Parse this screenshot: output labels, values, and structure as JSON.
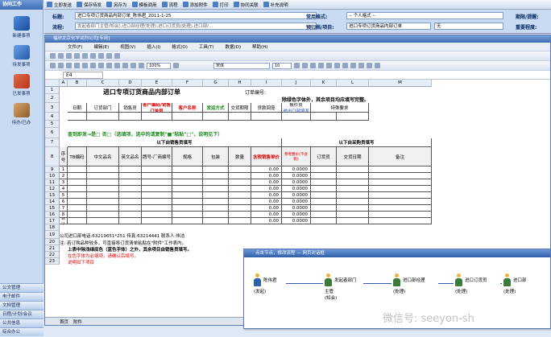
{
  "nav": {
    "header": "协同工作",
    "items": [
      {
        "label": "新建事项"
      },
      {
        "label": "待发事项"
      },
      {
        "label": "已发事项"
      },
      {
        "label": "待办/已办"
      }
    ],
    "bottom": [
      "公文管理",
      "电子邮件",
      "文档管理",
      "日程/计划/会议",
      "公共信息",
      "综合办公"
    ]
  },
  "toolbar": {
    "items": [
      "立即发送",
      "保存待发",
      "另存为",
      "模板调用",
      "流程",
      "添加附件",
      "打印",
      "协同关联",
      "补充说明"
    ]
  },
  "form": {
    "title_label": "标题:",
    "title_value": "进口专项订货商品内部订单_陈伟君_2011-1-25",
    "flow_label": "流程:",
    "flow_value": "发起者部门主管(知会),进口部经理(处理),进口订货员(处理),进口部/...",
    "common_label": "常用格式:",
    "common_value": "-- 个人格式 --",
    "tpl_label": "预归档/项目:",
    "tpl_value": "进口专项订货商品内部订单",
    "tpl_value2": "无",
    "deadline_label": "期限/提醒:",
    "importance_label": "重要程度:"
  },
  "excel": {
    "window_title": "福欣北京化学试剂公司[专用]",
    "menu": [
      "文件(F)",
      "编辑(E)",
      "视图(V)",
      "插入(I)",
      "格式(O)",
      "工具(T)",
      "数据(D)",
      "帮助(H)"
    ],
    "name_box": "E4",
    "font": "宋体",
    "size": "10",
    "zoom": "100%",
    "columns": [
      "A",
      "B",
      "C",
      "D",
      "E",
      "F",
      "G",
      "H",
      "I",
      "J",
      "K",
      "L",
      "M"
    ],
    "rows": [
      "1",
      "2",
      "3",
      "4",
      "5",
      "6",
      "7",
      "8",
      "9",
      "10",
      "11",
      "12",
      "13",
      "14",
      "15",
      "16",
      "17",
      "18",
      "19",
      "20",
      "21",
      "22",
      "23"
    ],
    "title": "进口专项订货商品内部订单",
    "order_no": "订单编号:",
    "note_row2": "除绿色字体外，其余项目均应填写完整。",
    "hdr3": {
      "date": "日期",
      "dept": "订货部门",
      "sales": "销售员",
      "customer": "客户编码/销售订单号",
      "cname": "客户名称",
      "ship": "发运方式",
      "trade": "交货期限",
      "pay": "贷款回笼",
      "reporter": "报价员",
      "reporter2": "进出口部填写",
      "special": "特殊要求"
    },
    "row6": "查到即发→是□  否□（选填项，选中的请复制\"■\"粘贴\"□\"，说明见下）",
    "sec_left": "以下由销售员填写",
    "sec_right": "以下由采购员填写",
    "hdr7": {
      "seq": "序号",
      "code": "TB编码",
      "cn": "中文品名",
      "en": "英文品名",
      "brand": "牌号-厂商编号",
      "spec": "规格",
      "pack": "包装",
      "qty": "数量",
      "price": "含税销售单价",
      "ref": "参考售价(不含税)",
      "buyer": "订货员",
      "date": "交货日期",
      "remark": "备注"
    },
    "data_rows": [
      {
        "n": "1",
        "v1": "0.00",
        "v2": "0.0000"
      },
      {
        "n": "2",
        "v1": "0.00",
        "v2": "0.0000"
      },
      {
        "n": "3",
        "v1": "0.00",
        "v2": "0.0000"
      },
      {
        "n": "4",
        "v1": "0.00",
        "v2": "0.0000"
      },
      {
        "n": "5",
        "v1": "0.00",
        "v2": "0.0000"
      },
      {
        "n": "6",
        "v1": "0.00",
        "v2": "0.0000"
      },
      {
        "n": "7",
        "v1": "0.00",
        "v2": "0.0000"
      },
      {
        "n": "8",
        "v1": "0.00",
        "v2": "0.0000"
      },
      {
        "n": "合计",
        "v1": "0.00",
        "v2": "0.0000"
      }
    ],
    "foot1": "公司进口部电话:63219651*251 传真:63214441 联系人:伟洁",
    "foot2": "注: 若订购品种较多，可直接将订货清单粘贴在\"附件\"工作表内。",
    "foot3": "上表中除浅绿底色（蓝色字体）之外，其余项目由销售员填写。",
    "foot4": "在色字体为必填项，请确认后填写。",
    "foot5": "说明如下项目",
    "sheet_tabs": [
      "首页",
      "附件"
    ]
  },
  "flow": {
    "title": "点击节点，修改流程 — 网页对话框",
    "nodes": [
      {
        "name": "陈伟君",
        "sub": "(发起)"
      },
      {
        "name": "发起者部门",
        "sub": "主管",
        "sub2": "(知会)"
      },
      {
        "name": "进口部经理",
        "sub": "(处理)"
      },
      {
        "name": "进口订货员",
        "sub": "(处理)"
      },
      {
        "name": "进口部",
        "sub": "(处理)"
      }
    ]
  },
  "watermark": "微信号: seeyon-sh"
}
